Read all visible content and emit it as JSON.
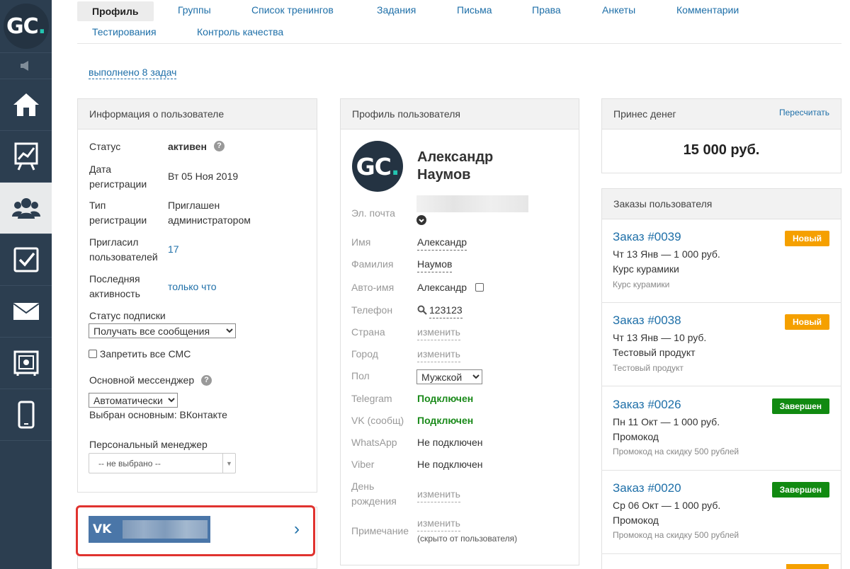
{
  "logo": {
    "text": "GC",
    "dot": "."
  },
  "sidebar": {
    "items": [
      {
        "name": "home"
      },
      {
        "name": "stats"
      },
      {
        "name": "users"
      },
      {
        "name": "tasks"
      },
      {
        "name": "mail"
      },
      {
        "name": "safe"
      },
      {
        "name": "mobile"
      }
    ],
    "active_index": 2
  },
  "tabs": [
    {
      "label": "Профиль",
      "active": true
    },
    {
      "label": "Группы"
    },
    {
      "label": "Список тренингов"
    },
    {
      "label": "Задания"
    },
    {
      "label": "Письма"
    },
    {
      "label": "Права"
    },
    {
      "label": "Анкеты"
    },
    {
      "label": "Комментарии"
    },
    {
      "label": "Тестирования"
    },
    {
      "label": "Контроль качества"
    }
  ],
  "tasks_link": "выполнено 8 задач",
  "user_info": {
    "title": "Информация о пользователе",
    "status_label": "Статус",
    "status_value": "активен",
    "help_mark": "?",
    "reg_date_label_1": "Дата",
    "reg_date_label_2": "регистрации",
    "reg_date_value": "Вт 05 Ноя 2019",
    "reg_type_label_1": "Тип",
    "reg_type_label_2": "регистрации",
    "reg_type_value_1": "Приглашен",
    "reg_type_value_2": "администратором",
    "invited_label_1": "Пригласил",
    "invited_label_2": "пользователей",
    "invited_value": "17",
    "last_activity_label_1": "Последняя",
    "last_activity_label_2": "активность",
    "last_activity_value": "только что",
    "subscription_label": "Статус подписки",
    "subscription_value": "Получать все сообщения",
    "sms_label": "Запретить все СМС",
    "messenger_label": "Основной мессенджер",
    "messenger_value": "Автоматически",
    "messenger_note": "Выбран основным: ВКонтакте",
    "manager_label": "Персональный менеджер",
    "manager_value": "-- не выбрано --"
  },
  "vk_widget": {
    "logo": "VK",
    "arrow": "›"
  },
  "profile": {
    "title": "Профиль пользователя",
    "avatar": {
      "text": "GC",
      "dot": "."
    },
    "name_first": "Александр",
    "name_last": "Наумов",
    "email_label": "Эл. почта",
    "first_name_label": "Имя",
    "first_name_value": "Александр",
    "last_name_label": "Фамилия",
    "last_name_value": "Наумов",
    "autoname_label": "Авто-имя",
    "autoname_value": "Александр",
    "phone_label": "Телефон",
    "phone_value": "123123",
    "country_label": "Страна",
    "city_label": "Город",
    "change_link": "изменить",
    "gender_label": "Пол",
    "gender_value": "Мужской",
    "telegram_label": "Telegram",
    "telegram_value": "Подключен",
    "vk_label": "VK (сообщ)",
    "vk_value": "Подключен",
    "whatsapp_label": "WhatsApp",
    "whatsapp_value": "Не подключен",
    "viber_label": "Viber",
    "viber_value": "Не подключен",
    "birthday_label_1": "День",
    "birthday_label_2": "рождения",
    "note_label": "Примечание",
    "note_hint": "(скрыто от пользователя)"
  },
  "money": {
    "title": "Принес денег",
    "recalc": "Пересчитать",
    "amount": "15 000 руб."
  },
  "orders": {
    "title": "Заказы пользователя",
    "items": [
      {
        "number": "Заказ #0039",
        "status": "Новый",
        "status_color": "#f5a000",
        "line": "Чт 13 Янв — 1 000 руб.",
        "product": "Курс курамики",
        "product_small": "Курс курамики"
      },
      {
        "number": "Заказ #0038",
        "status": "Новый",
        "status_color": "#f5a000",
        "line": "Чт 13 Янв — 10 руб.",
        "product": "Тестовый продукт",
        "product_small": "Тестовый продукт"
      },
      {
        "number": "Заказ #0026",
        "status": "Завершен",
        "status_color": "#118a11",
        "line": "Пн 11 Окт — 1 000 руб.",
        "product": "Промокод",
        "product_small": "Промокод на скидку 500 рублей"
      },
      {
        "number": "Заказ #0020",
        "status": "Завершен",
        "status_color": "#118a11",
        "line": "Ср 06 Окт — 1 000 руб.",
        "product": "Промокод",
        "product_small": "Промокод на скидку 500 рублей"
      }
    ]
  },
  "colors": {
    "link": "#1e6fa8",
    "sidebar": "#2c3e50",
    "accent": "#23c4b0",
    "highlight_border": "#e0332f",
    "vk_blue": "#4a76a8"
  }
}
